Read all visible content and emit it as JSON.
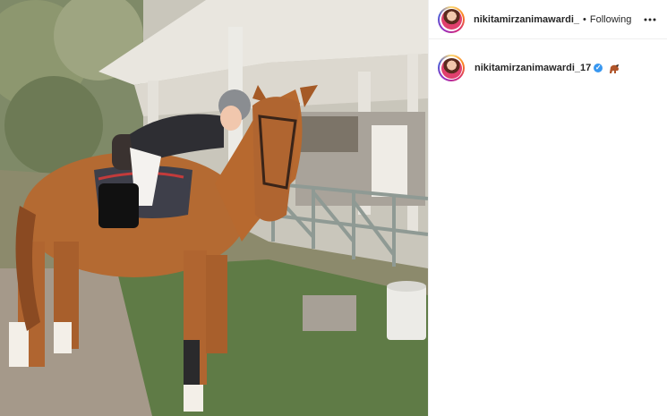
{
  "post": {
    "photo_label": "horse-riding-photo",
    "header": {
      "username": "nikitamirzanimawardi_",
      "separator": "•",
      "follow_status": "Following",
      "more_icon": "more-horizontal-icon"
    },
    "caption": {
      "username": "nikitamirzanimawardi_17",
      "verified_icon": "verified-badge-icon",
      "emoji_icon": "horse-emoji-icon"
    }
  },
  "colors": {
    "text": "#262626",
    "verified": "#3897f0",
    "border": "#efefef"
  }
}
